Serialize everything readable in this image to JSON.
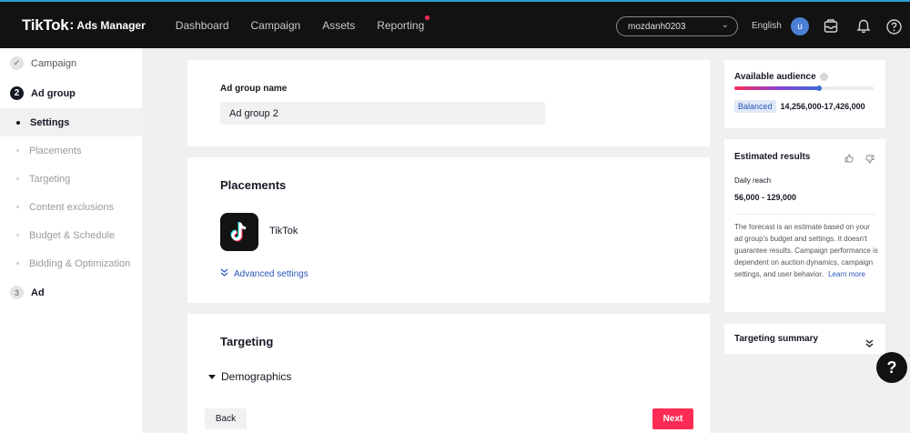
{
  "app": {
    "brand": "TikTok",
    "brand_sep": ":",
    "product": "Ads Manager"
  },
  "nav": {
    "items": [
      "Dashboard",
      "Campaign",
      "Assets",
      "Reporting"
    ]
  },
  "topbar": {
    "account": "mozdanh0203",
    "language": "English",
    "avatar_initial": "u"
  },
  "sidebar": {
    "campaign": "Campaign",
    "ad_group_number": "2",
    "ad_group": "Ad group",
    "sub_items": [
      "Settings",
      "Placements",
      "Targeting",
      "Content exclusions",
      "Budget & Schedule",
      "Bidding & Optimization"
    ],
    "ad_number": "3",
    "ad": "Ad"
  },
  "ad_group_name": {
    "label": "Ad group name",
    "value": "Ad group 2"
  },
  "placements": {
    "title": "Placements",
    "app_name": "TikTok",
    "advanced": "Advanced settings"
  },
  "targeting": {
    "title": "Targeting",
    "demographics": "Demographics"
  },
  "footer": {
    "back": "Back",
    "next": "Next"
  },
  "audience": {
    "title": "Available audience",
    "status": "Balanced",
    "range": "14,256,000-17,426,000",
    "level": 0.61
  },
  "estimated": {
    "title": "Estimated results",
    "reach_label": "Daily reach",
    "reach_value": "56,000 - 129,000",
    "note": "The forecast is an estimate based on your ad group's budget and settings. It doesn't guarantee results. Campaign performance is dependent on auction dynamics, campaign settings, and user behavior.",
    "learn_more": "Learn more"
  },
  "summary": {
    "title": "Targeting summary"
  },
  "colors": {
    "accent": "#fe2c55",
    "link": "#2a55b8",
    "topbar": "#121212"
  }
}
